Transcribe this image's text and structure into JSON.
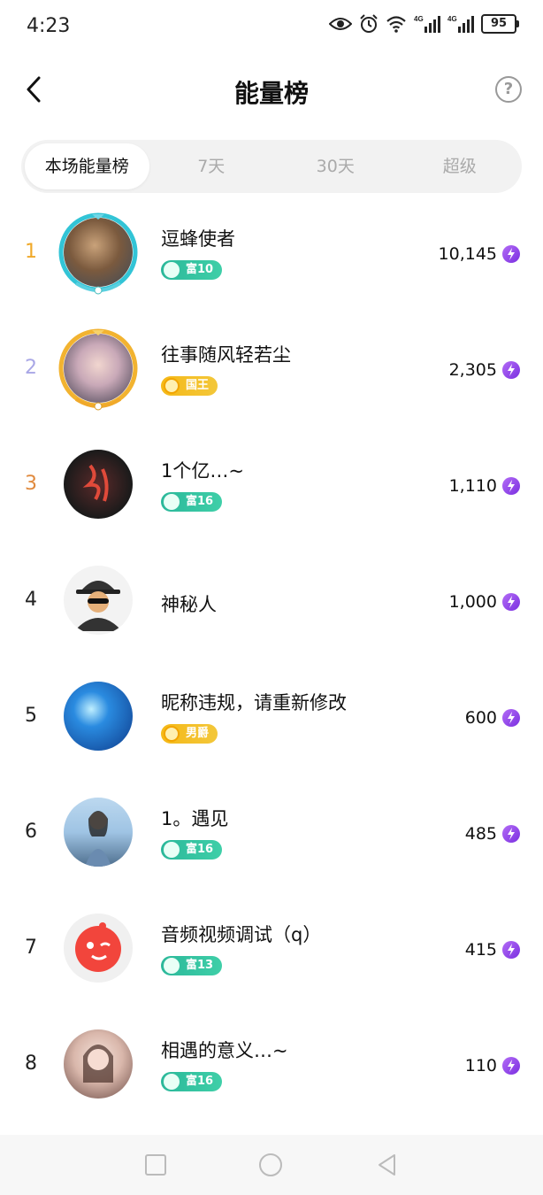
{
  "status": {
    "time": "4:23",
    "battery": "95",
    "net1": "4G",
    "net2": "4G"
  },
  "header": {
    "title": "能量榜",
    "help": "?"
  },
  "tabs": [
    {
      "label": "本场能量榜",
      "active": true
    },
    {
      "label": "7天",
      "active": false
    },
    {
      "label": "30天",
      "active": false
    },
    {
      "label": "超级",
      "active": false
    }
  ],
  "rows": [
    {
      "rank": "1",
      "name": "逗蜂使者",
      "badge": "富10",
      "badge_color": "green",
      "score": "10,145"
    },
    {
      "rank": "2",
      "name": "往事随风轻若尘",
      "badge": "国王",
      "badge_color": "gold",
      "score": "2,305"
    },
    {
      "rank": "3",
      "name": "1个亿…~",
      "badge": "富16",
      "badge_color": "green",
      "score": "1,110"
    },
    {
      "rank": "4",
      "name": "神秘人",
      "badge": "",
      "badge_color": "",
      "score": "1,000"
    },
    {
      "rank": "5",
      "name": "昵称违规，请重新修改",
      "badge": "男爵",
      "badge_color": "gold",
      "score": "600"
    },
    {
      "rank": "6",
      "name": "1。遇见",
      "badge": "富16",
      "badge_color": "green",
      "score": "485"
    },
    {
      "rank": "7",
      "name": "音频视频调试（q）",
      "badge": "富13",
      "badge_color": "green",
      "score": "415"
    },
    {
      "rank": "8",
      "name": "相遇的意义…~",
      "badge": "富16",
      "badge_color": "green",
      "score": "110"
    }
  ],
  "colors": {
    "rank1": "#f0a92a",
    "rank2": "#a9a7e6",
    "rank3": "#e08a3e",
    "energy_icon": "#9b4dea",
    "green_badge": "#2bb89a",
    "gold_badge": "#f5b918"
  },
  "icons": {
    "back": "chevron-left-icon",
    "help": "question-circle-icon",
    "energy": "lightning-icon"
  }
}
